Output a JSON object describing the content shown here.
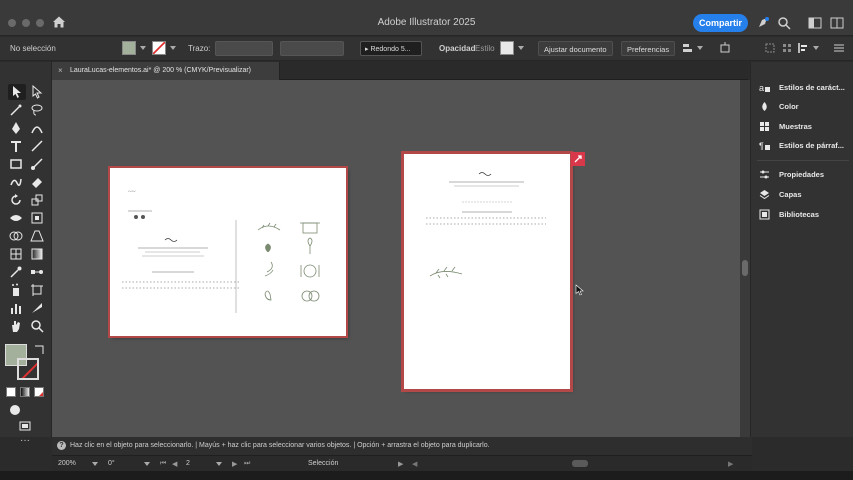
{
  "window": {
    "title": "Adobe Illustrator 2025",
    "share_label": "Compartir"
  },
  "control_bar": {
    "selection_label": "No selección",
    "stroke_label": "Trazo:",
    "brush_label": "Redondo 5...",
    "opacity_label": "Opacidad",
    "style_label": "Estilo",
    "fit_document_label": "Ajustar documento",
    "preferences_label": "Preferencias"
  },
  "document_tab": {
    "label": "LauraLucas-elementos.ai* @ 200 % (CMYK/Previsualizar)",
    "close_glyph": "×"
  },
  "right_panel": {
    "items": [
      {
        "label": "Estilos de caráct...",
        "icon": "character-styles-icon"
      },
      {
        "label": "Color",
        "icon": "color-icon"
      },
      {
        "label": "Muestras",
        "icon": "swatches-icon"
      },
      {
        "label": "Estilos de párraf...",
        "icon": "paragraph-styles-icon"
      },
      {
        "label": "Propiedades",
        "icon": "properties-icon"
      },
      {
        "label": "Capas",
        "icon": "layers-icon"
      },
      {
        "label": "Bibliotecas",
        "icon": "libraries-icon"
      }
    ]
  },
  "status": {
    "hint": "Haz clic en el objeto para seleccionarlo.  |  Mayús + haz clic para seleccionar varios objetos.  |  Opción + arrastra el objeto para duplicarlo.",
    "zoom": "200%",
    "rotation": "0°",
    "artboard_number": "2",
    "tool_name": "Selección"
  },
  "colors": {
    "accent": "#2680eb",
    "fill": "#a3b09c",
    "artboard_border": "#b24848",
    "canvas": "#535353"
  }
}
